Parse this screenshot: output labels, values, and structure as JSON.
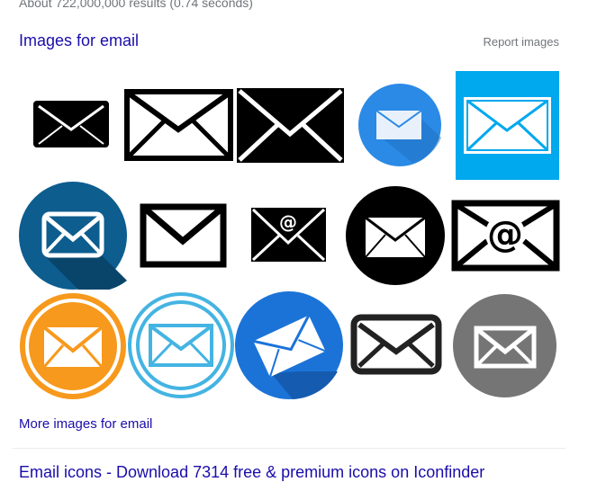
{
  "results_stats": "About 722,000,000 results (0.74 seconds)",
  "images_block": {
    "title": "Images for email",
    "report_label": "Report images",
    "thumbnails": [
      {
        "icon": "envelope-small-black-icon",
        "bg": "#ffffff",
        "fg": "#000000"
      },
      {
        "icon": "envelope-outline-black-icon",
        "bg": "#ffffff",
        "fg": "#000000"
      },
      {
        "icon": "envelope-bold-black-icon",
        "bg": "#ffffff",
        "fg": "#000000"
      },
      {
        "icon": "envelope-blue-circle-icon",
        "bg": "#2b8ae6",
        "fg": "#ffffff"
      },
      {
        "icon": "envelope-cyan-square-icon",
        "bg": "#00a8ee",
        "fg": "#ffffff"
      },
      {
        "icon": "envelope-dark-blue-circle-icon",
        "bg": "#0d5d8f",
        "fg": "#ffffff"
      },
      {
        "icon": "envelope-black-stroke-icon",
        "bg": "#ffffff",
        "fg": "#000000"
      },
      {
        "icon": "envelope-at-sign-small-icon",
        "bg": "#ffffff",
        "fg": "#000000"
      },
      {
        "icon": "envelope-black-circle-icon",
        "bg": "#000000",
        "fg": "#ffffff"
      },
      {
        "icon": "envelope-at-sign-outline-icon",
        "bg": "#ffffff",
        "fg": "#000000"
      },
      {
        "icon": "envelope-orange-circle-icon",
        "bg": "#f7991c",
        "fg": "#ffffff"
      },
      {
        "icon": "envelope-light-blue-ring-icon",
        "bg": "#44b4e2",
        "fg": "#44b4e2"
      },
      {
        "icon": "envelope-blue-circle-tilted-icon",
        "bg": "#1b73d8",
        "fg": "#ffffff"
      },
      {
        "icon": "envelope-rounded-outline-icon",
        "bg": "#ffffff",
        "fg": "#222222"
      },
      {
        "icon": "envelope-gray-circle-icon",
        "bg": "#757575",
        "fg": "#ffffff"
      }
    ],
    "more_link": "More images for email"
  },
  "next_result": {
    "title": "Email icons - Download 7314 free & premium icons on Iconfinder"
  }
}
